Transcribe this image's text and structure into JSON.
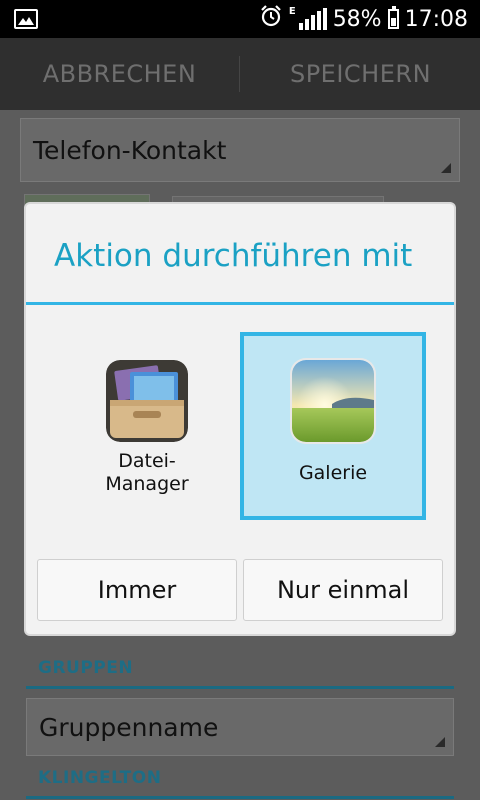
{
  "status_bar": {
    "network_type": "E",
    "battery_percent": "58%",
    "time": "17:08",
    "battery_level": 0.58,
    "icons": [
      "image-notification-icon",
      "alarm-icon",
      "signal-icon",
      "battery-icon"
    ]
  },
  "action_bar": {
    "cancel_label": "ABBRECHEN",
    "save_label": "SPEICHERN"
  },
  "form": {
    "account_type": "Telefon-Kontakt",
    "groups_header": "GRUPPEN",
    "group_name_placeholder": "Gruppenname",
    "ringtone_header": "KLINGELTON"
  },
  "dialog": {
    "title": "Aktion durchführen mit",
    "apps": [
      {
        "label_line1": "Datei-",
        "label_line2": "Manager",
        "icon": "file-manager-icon",
        "selected": false
      },
      {
        "label": "Galerie",
        "icon": "gallery-icon",
        "selected": true
      }
    ],
    "always_label": "Immer",
    "just_once_label": "Nur einmal"
  },
  "colors": {
    "accent": "#33b5e5",
    "selected_bg": "#bfe6f4",
    "title": "#1ba1c4"
  }
}
